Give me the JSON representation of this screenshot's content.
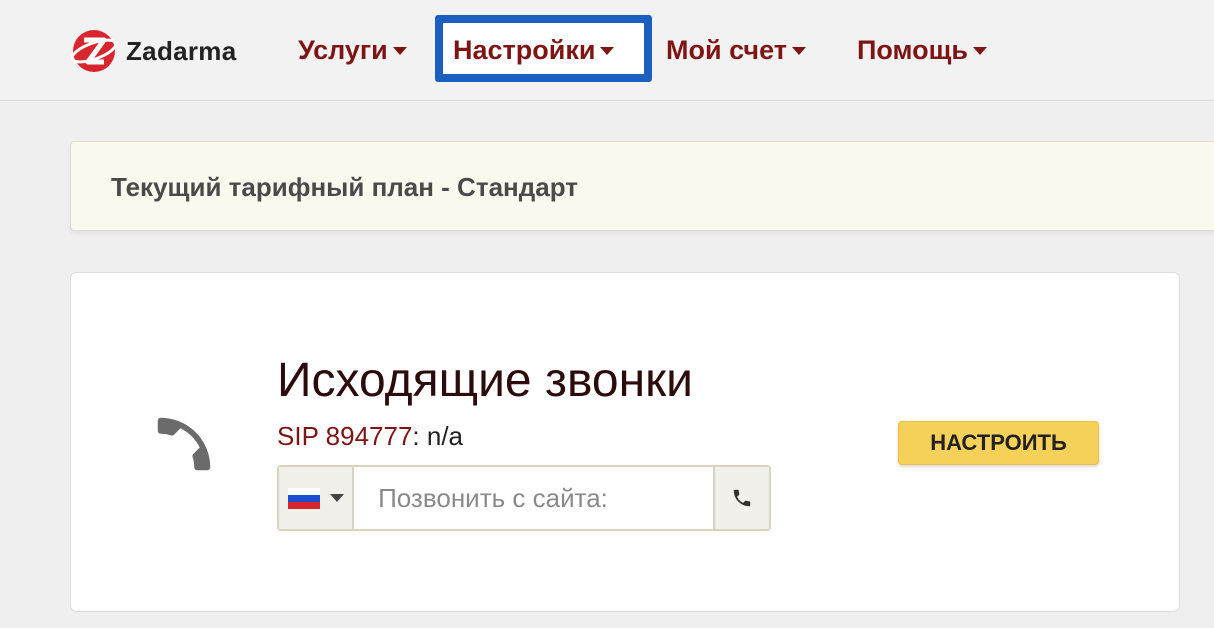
{
  "brand": {
    "name": "Zadarma"
  },
  "nav": {
    "items": [
      {
        "label": "Услуги"
      },
      {
        "label": "Настройки"
      },
      {
        "label": "Мой счет"
      },
      {
        "label": "Помощь"
      }
    ],
    "active_index": 1
  },
  "tariff": {
    "text": "Текущий тарифный план - Стандарт"
  },
  "outgoing": {
    "title": "Исходящие звонки",
    "sip_label": "SIP 894777",
    "sip_value": ": n/a",
    "dial_placeholder": "Позвонить с сайта:",
    "dial_value": "",
    "country_flag": "ru",
    "configure_label": "НАСТРОИТЬ"
  },
  "colors": {
    "nav_text": "#7e1515",
    "active_highlight": "#1b5fbf",
    "tariff_bg": "#fbf8ee",
    "button_yellow": "#f6d15a",
    "logo_red": "#d8262f"
  },
  "icons": {
    "logo": "zadarma-logo-icon",
    "phone_large": "phone-icon",
    "phone_call": "phone-call-icon",
    "flag": "russia-flag-icon",
    "dropdown": "chevron-down-icon"
  }
}
